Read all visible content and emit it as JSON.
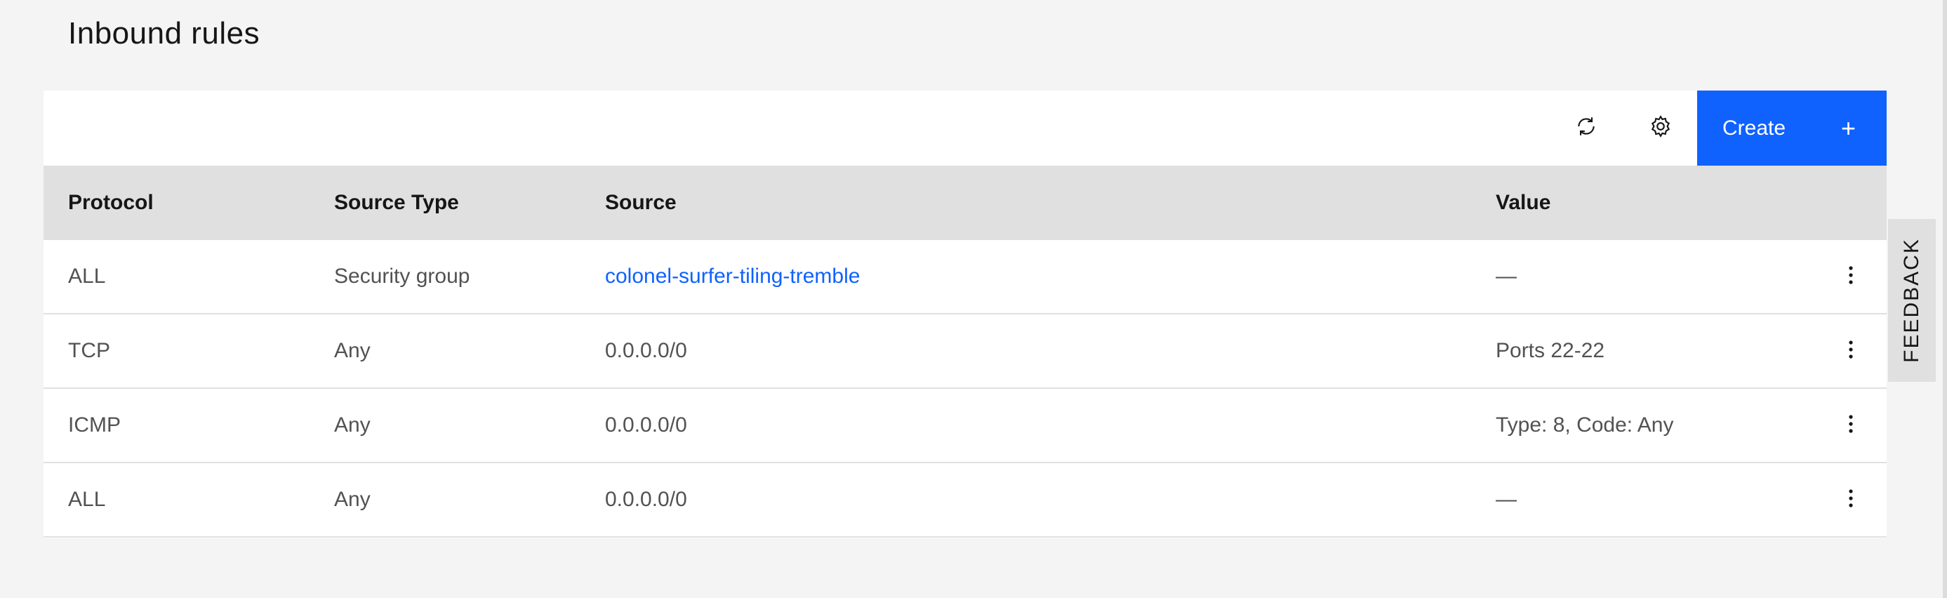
{
  "page": {
    "title": "Inbound rules"
  },
  "toolbar": {
    "refresh_icon": "refresh-icon",
    "settings_icon": "gear-icon",
    "create_label": "Create",
    "create_icon": "+"
  },
  "table": {
    "columns": [
      "Protocol",
      "Source Type",
      "Source",
      "Value"
    ],
    "rows": [
      {
        "protocol": "ALL",
        "source_type": "Security group",
        "source": "colonel-surfer-tiling-tremble",
        "value": "—"
      },
      {
        "protocol": "TCP",
        "source_type": "Any",
        "source": "0.0.0.0/0",
        "value": "Ports 22-22"
      },
      {
        "protocol": "ICMP",
        "source_type": "Any",
        "source": "0.0.0.0/0",
        "value": "Type: 8, Code: Any"
      },
      {
        "protocol": "ALL",
        "source_type": "Any",
        "source": "0.0.0.0/0",
        "value": "—"
      }
    ]
  },
  "feedback": {
    "label": "FEEDBACK"
  },
  "colors": {
    "accent": "#0f62fe",
    "header_bg": "#e0e0e0",
    "page_bg": "#f4f4f4"
  }
}
